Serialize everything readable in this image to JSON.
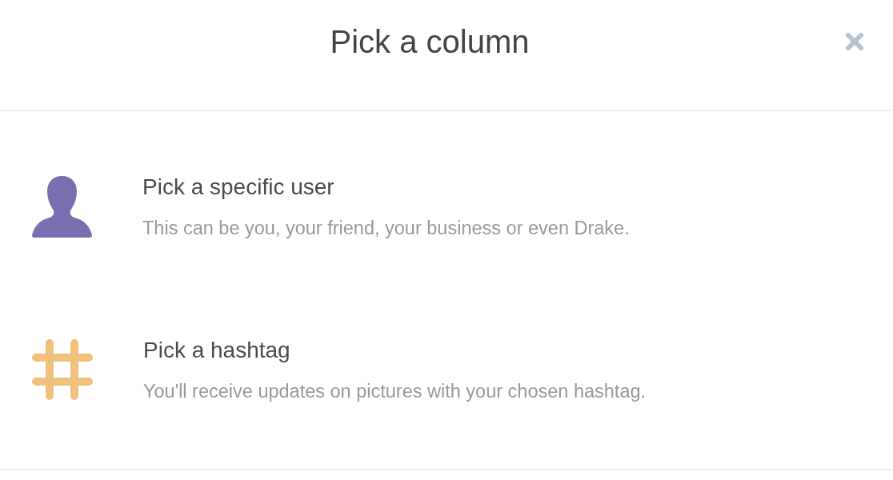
{
  "dialog": {
    "title": "Pick a column",
    "options": [
      {
        "kind": "user",
        "title": "Pick a specific user",
        "description": "This can be you, your friend, your business or even Drake."
      },
      {
        "kind": "hashtag",
        "title": "Pick a hashtag",
        "description": "You'll receive updates on pictures with your chosen hashtag."
      }
    ]
  }
}
